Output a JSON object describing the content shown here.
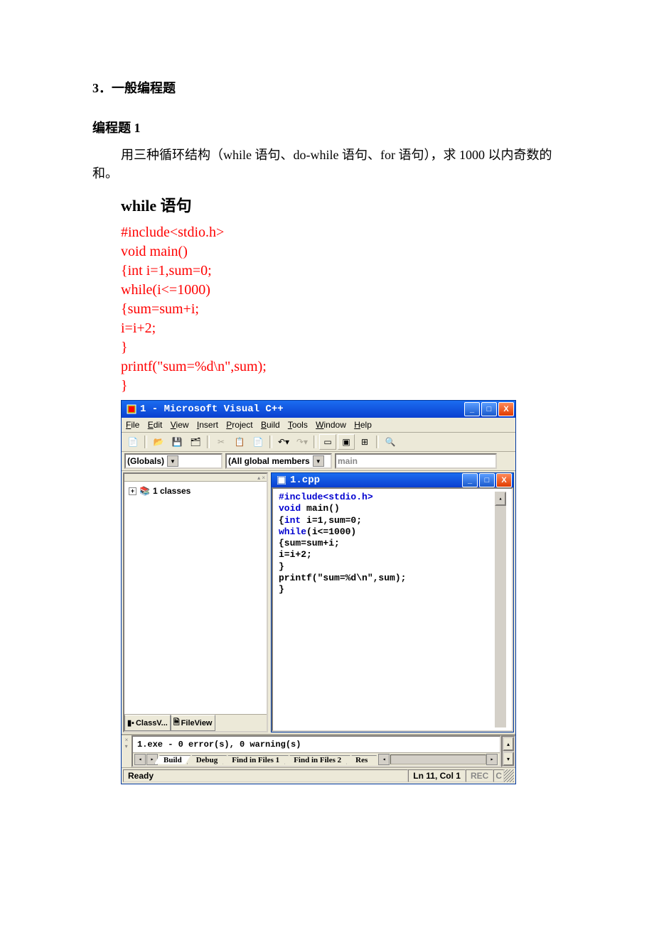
{
  "headings": {
    "section": "3．一般编程题",
    "problem": "编程题 1",
    "method": "while 语句"
  },
  "paragraph": "用三种循环结构（while 语句、do-while 语句、for 语句），求 1000 以内奇数的和。",
  "code": {
    "l1": "#include<stdio.h>",
    "l2": "void main()",
    "l3": "{int i=1,sum=0;",
    "l4": "while(i<=1000)",
    "l5": "{sum=sum+i;",
    "l6": "i=i+2;",
    "l7": "}",
    "l8": "printf(\"sum=%d\\n\",sum);",
    "l9": "}"
  },
  "window": {
    "title": "1 - Microsoft Visual C++",
    "menu": {
      "file": "File",
      "edit": "Edit",
      "view": "View",
      "insert": "Insert",
      "project": "Project",
      "build": "Build",
      "tools": "Tools",
      "window": "Window",
      "help": "Help"
    },
    "combos": {
      "globals": "(Globals)",
      "members": "(All global members",
      "func": "main"
    },
    "tree": {
      "root": "1 classes"
    },
    "side_tabs": {
      "classv": "ClassV...",
      "fileview": "FileView"
    },
    "inner": {
      "title": "1.cpp",
      "code": {
        "l1a": "#include",
        "l1b": "<stdio.h>",
        "l2a": "void",
        "l2b": " main()",
        "l3a": "{",
        "l3b": "int",
        "l3c": " i=1,sum=0;",
        "l4a": "while",
        "l4b": "(i<=1000)",
        "l5": "{sum=sum+i;",
        "l6": "i=i+2;",
        "l7": "}",
        "l8": "printf(\"sum=%d\\n\",sum);",
        "l9": "}"
      }
    },
    "output": {
      "text": "1.exe - 0 error(s), 0 warning(s)",
      "tabs": {
        "build": "Build",
        "debug": "Debug",
        "ff1": "Find in Files 1",
        "ff2": "Find in Files 2",
        "res": "Res"
      }
    },
    "status": {
      "ready": "Ready",
      "pos": "Ln 11, Col 1",
      "rec": "REC",
      "c": "C"
    }
  }
}
